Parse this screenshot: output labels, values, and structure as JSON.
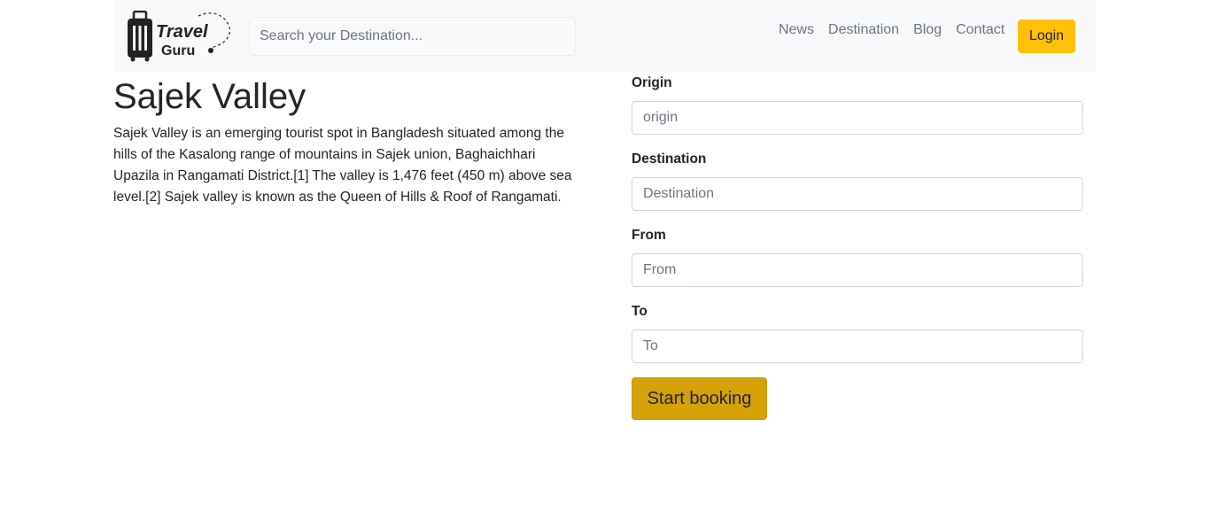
{
  "navbar": {
    "logo_text_line1": "Travel",
    "logo_text_line2": "Guru",
    "search_placeholder": "Search your Destination...",
    "links": [
      "News",
      "Destination",
      "Blog",
      "Contact"
    ],
    "login_label": "Login"
  },
  "main": {
    "title": "Sajek Valley",
    "description": "Sajek Valley is an emerging tourist spot in Bangladesh situated among the hills of the Kasalong range of mountains in Sajek union, Baghaichhari Upazila in Rangamati District.[1] The valley is 1,476 feet (450 m) above sea level.[2] Sajek valley is known as the Queen of Hills & Roof of Rangamati."
  },
  "booking_form": {
    "origin_label": "Origin",
    "origin_placeholder": "origin",
    "destination_label": "Destination",
    "destination_placeholder": "Destination",
    "from_label": "From",
    "from_placeholder": "From",
    "to_label": "To",
    "to_placeholder": "To",
    "submit_label": "Start booking"
  },
  "colors": {
    "navbar_bg": "#f8f9fa",
    "login_button": "#ffc107",
    "start_button": "#d4a106",
    "nav_link": "#6c757d"
  },
  "icons": [
    "suitcase-icon",
    "dotted-path-icon"
  ]
}
